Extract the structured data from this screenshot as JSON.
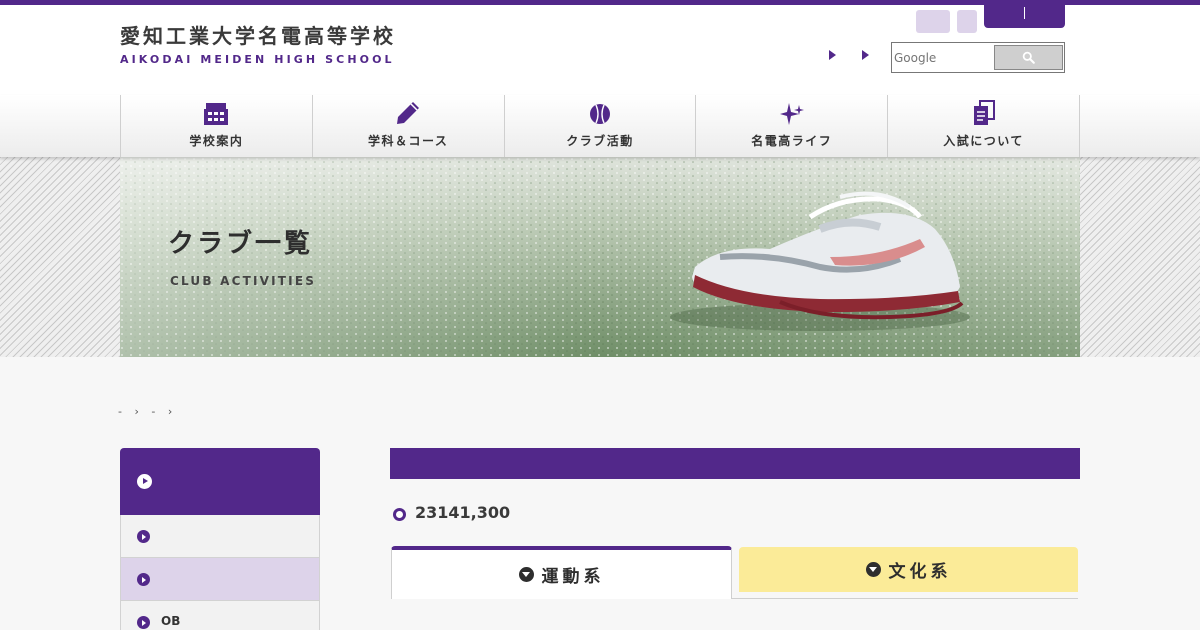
{
  "header": {
    "logo_jp": "愛知工業大学名電高等学校",
    "logo_en": "AIKODAI MEIDEN HIGH SCHOOL",
    "search": {
      "placeholder": "Google",
      "button_icon": "search-icon"
    }
  },
  "nav": {
    "items": [
      {
        "label": "学校案内",
        "icon": "school-building-icon"
      },
      {
        "label": "学科＆コース",
        "icon": "pencil-icon"
      },
      {
        "label": "クラブ活動",
        "icon": "ball-icon"
      },
      {
        "label": "名電高ライフ",
        "icon": "sparkle-icon"
      },
      {
        "label": "入試について",
        "icon": "documents-icon"
      }
    ]
  },
  "hero": {
    "title": "クラブ一覧",
    "subtitle": "CLUB ACTIVITIES"
  },
  "breadcrumb": {
    "items": [
      "-",
      "›",
      "-",
      "›"
    ]
  },
  "sidebar": {
    "items": [
      {
        "label": ""
      },
      {
        "label": ""
      },
      {
        "label": "OB"
      }
    ]
  },
  "content": {
    "count_text": "23141,300"
  },
  "tabs": {
    "sports": "運動系",
    "culture": "文化系"
  },
  "colors": {
    "brand": "#52288a",
    "brand_light": "#ddd3ea",
    "culture_tab": "#fbeb98"
  }
}
